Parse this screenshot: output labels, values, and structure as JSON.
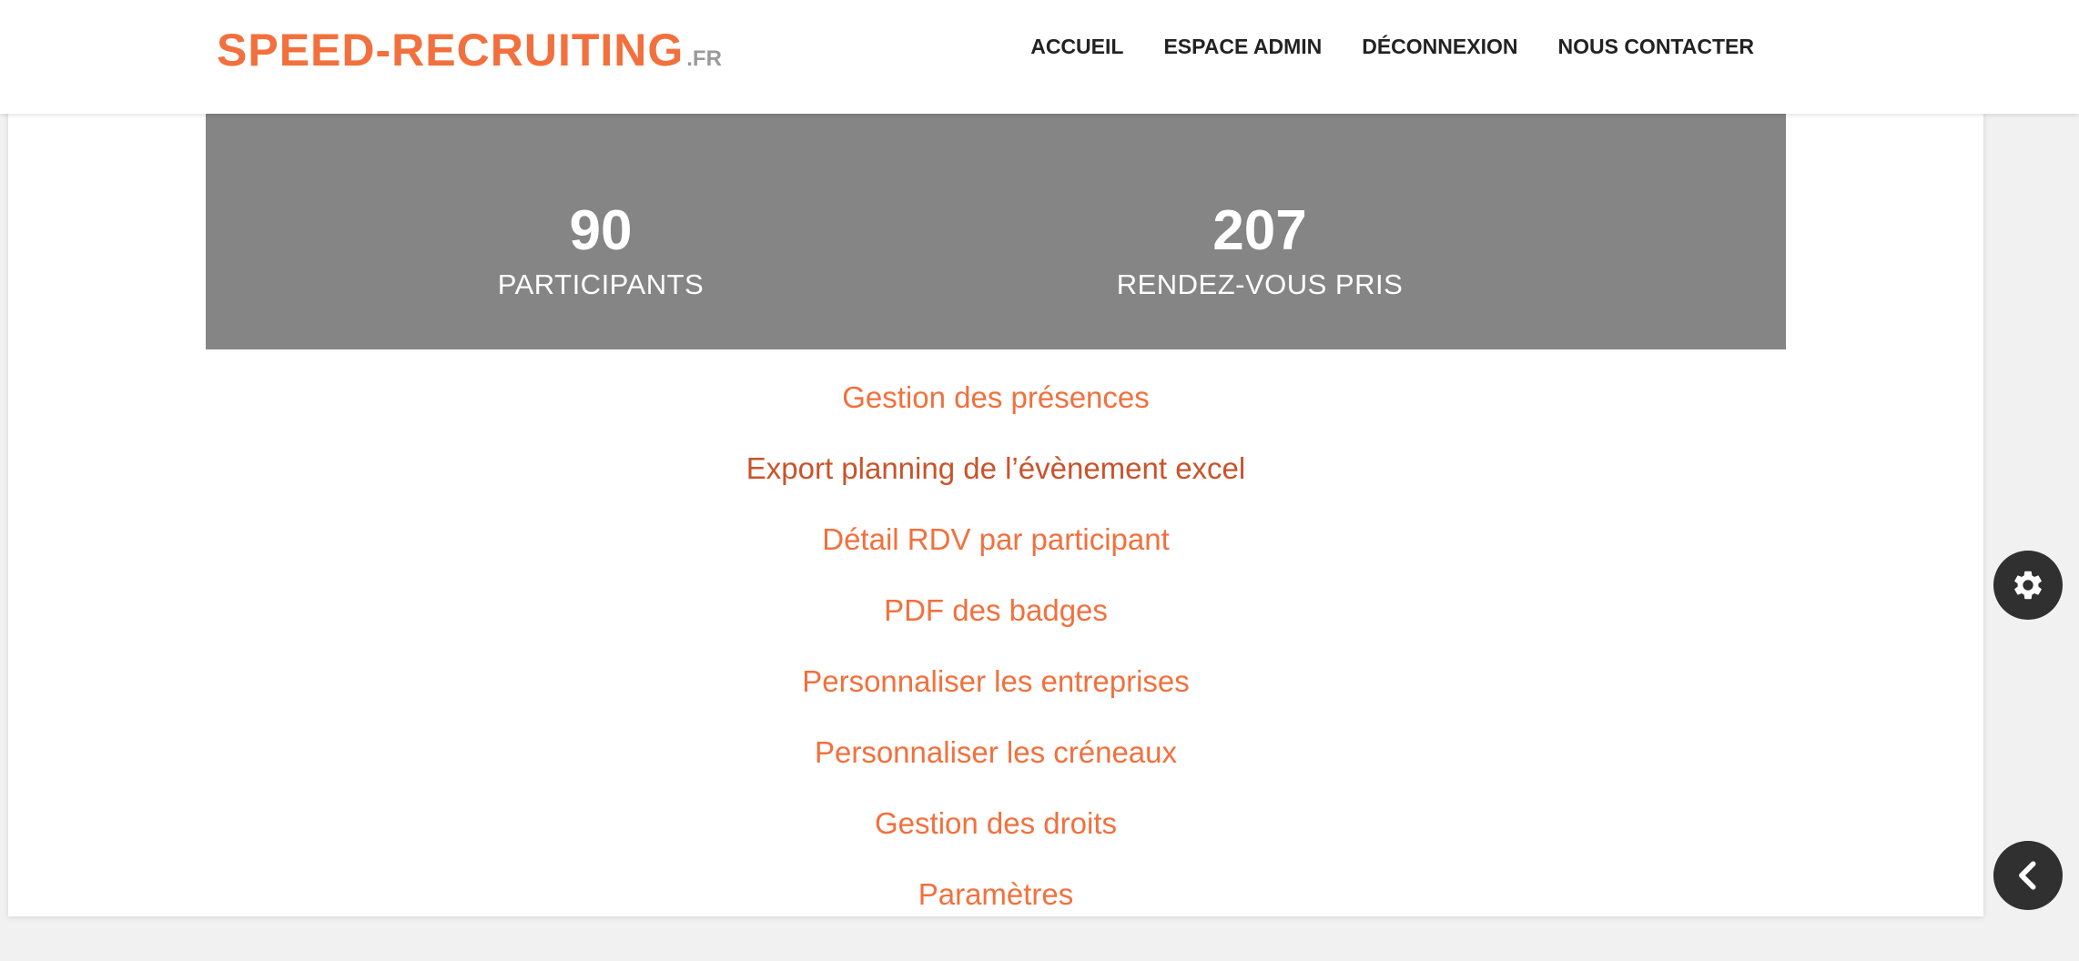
{
  "header": {
    "logo_main": "SPEED-RECRUITING",
    "logo_ext": ".FR",
    "nav": [
      {
        "label": "ACCUEIL"
      },
      {
        "label": "ESPACE ADMIN"
      },
      {
        "label": "DÉCONNEXION"
      },
      {
        "label": "NOUS CONTACTER"
      }
    ]
  },
  "stats": [
    {
      "value": "90",
      "label": "PARTICIPANTS"
    },
    {
      "value": "207",
      "label": "RENDEZ-VOUS PRIS"
    }
  ],
  "menu": [
    {
      "label": "Gestion des présences"
    },
    {
      "label": "Export planning de l’évènement excel"
    },
    {
      "label": "Détail RDV par participant"
    },
    {
      "label": "PDF des badges"
    },
    {
      "label": "Personnaliser les entreprises"
    },
    {
      "label": "Personnaliser les créneaux"
    },
    {
      "label": "Gestion des droits"
    },
    {
      "label": "Paramètres"
    }
  ],
  "floating_buttons": {
    "settings_icon": "gear-icon",
    "back_icon": "chevron-left-icon"
  },
  "colors": {
    "accent": "#f2703d",
    "accent_hover": "#c9532a",
    "stats_band": "#858585",
    "float_button": "#303030"
  }
}
